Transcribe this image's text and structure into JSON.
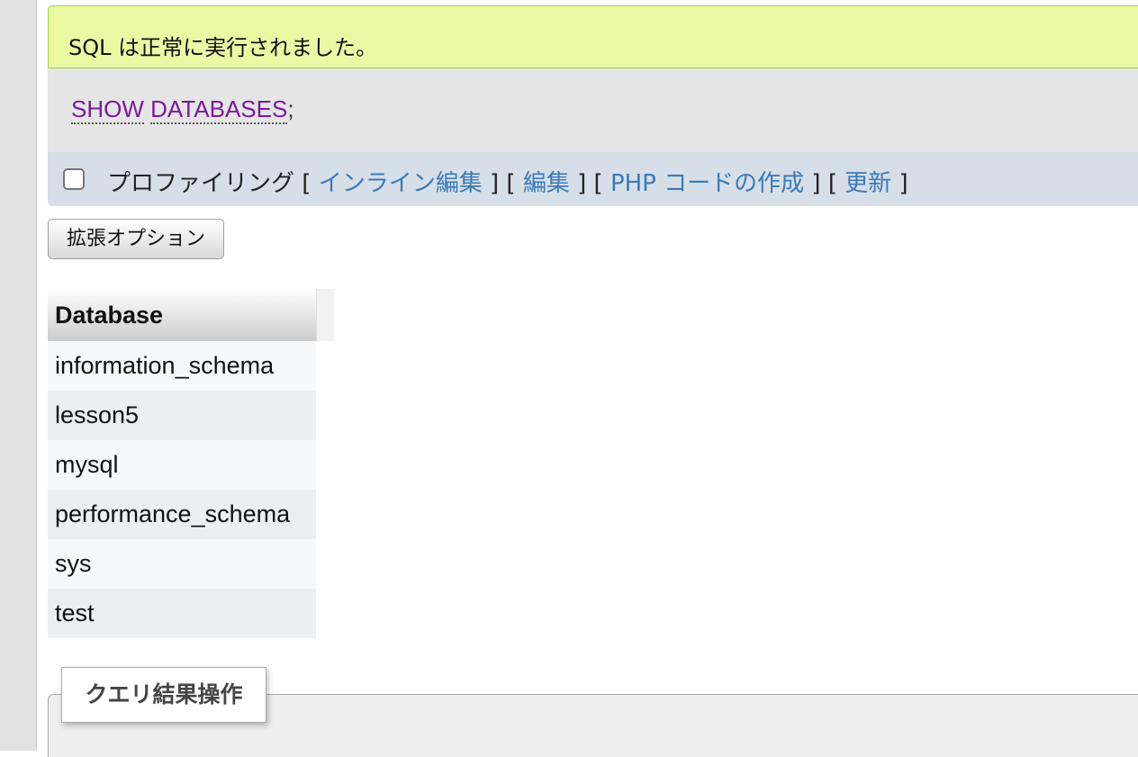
{
  "message": {
    "success_text": "SQL は正常に実行されました。"
  },
  "sql": {
    "keyword_1": "SHOW",
    "keyword_2": "DATABASES",
    "terminator": ";"
  },
  "tools": {
    "profiling_label": "プロファイリング",
    "profiling_checked": false,
    "open_bracket": "[",
    "close_bracket": "]",
    "inline_edit": "インライン編集",
    "edit": "編集",
    "create_php": "PHP コードの作成",
    "refresh": "更新"
  },
  "options": {
    "extended_options_label": "拡張オプション"
  },
  "results": {
    "header": "Database",
    "rows": [
      "information_schema",
      "lesson5",
      "mysql",
      "performance_schema",
      "sys",
      "test"
    ]
  },
  "query_ops": {
    "legend": "クエリ結果操作"
  },
  "colors": {
    "success_bg": "#ebf8a4",
    "sql_keyword": "#7a1b9c",
    "link": "#3a7ab8"
  }
}
